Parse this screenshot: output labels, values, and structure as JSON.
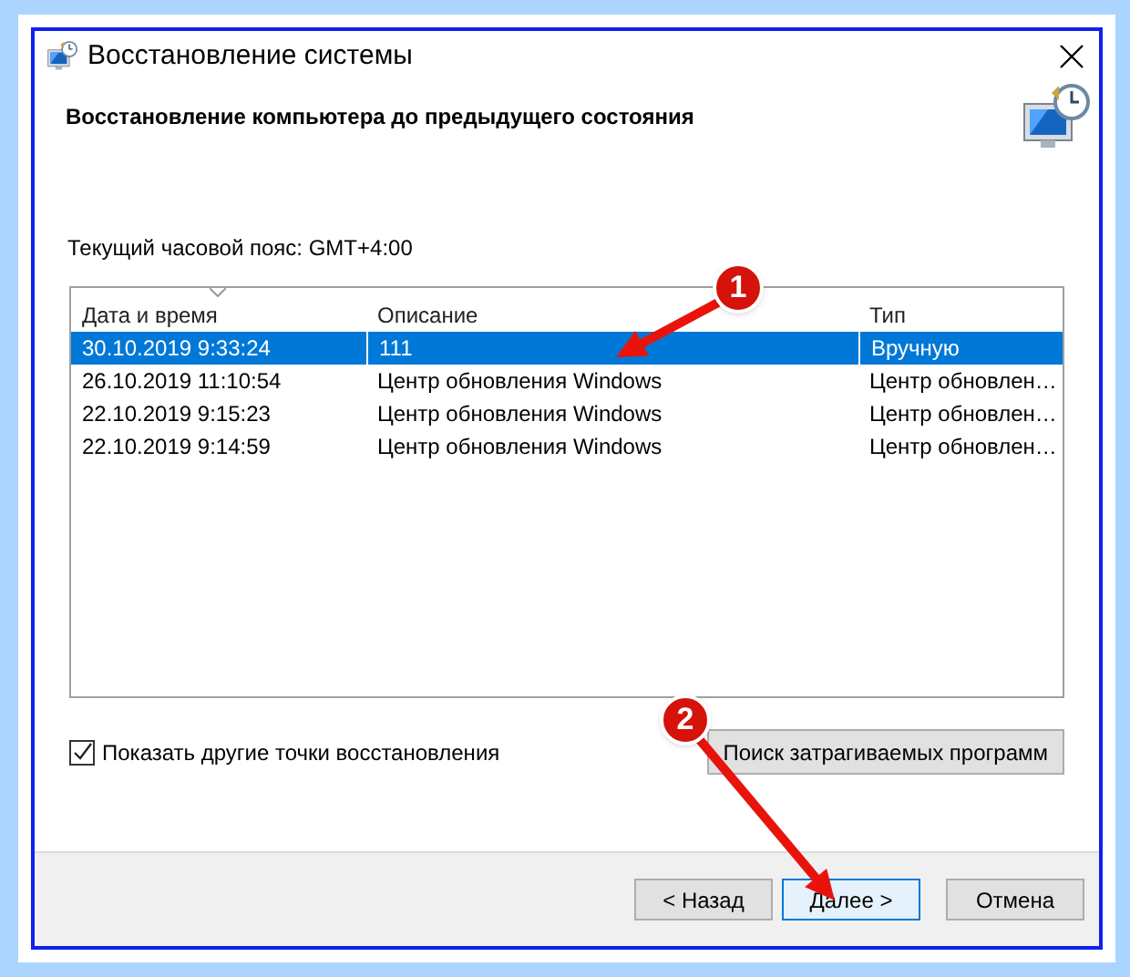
{
  "window": {
    "title": "Восстановление системы"
  },
  "heading": "Восстановление компьютера до предыдущего состояния",
  "timezone": "Текущий часовой пояс: GMT+4:00",
  "table": {
    "columns": [
      {
        "label": "Дата и время",
        "sorted": true
      },
      {
        "label": "Описание",
        "sorted": false
      },
      {
        "label": "Тип",
        "sorted": false
      }
    ],
    "rows": [
      {
        "cells": [
          "30.10.2019 9:33:24",
          "111",
          "Вручную"
        ],
        "selected": true
      },
      {
        "cells": [
          "26.10.2019 11:10:54",
          "Центр обновления Windows",
          "Центр обновлен…"
        ],
        "selected": false
      },
      {
        "cells": [
          "22.10.2019 9:15:23",
          "Центр обновления Windows",
          "Центр обновлен…"
        ],
        "selected": false
      },
      {
        "cells": [
          "22.10.2019 9:14:59",
          "Центр обновления Windows",
          "Центр обновлен…"
        ],
        "selected": false
      }
    ]
  },
  "show_more": {
    "label": "Показать другие точки восстановления",
    "checked": true
  },
  "scan_button": "Поиск затрагиваемых программ",
  "buttons": [
    {
      "label": "< Назад",
      "default": false
    },
    {
      "label": "Далее >",
      "default": true
    },
    {
      "label": "Отмена",
      "default": false
    }
  ],
  "annotations": [
    {
      "number": "1"
    },
    {
      "number": "2"
    }
  ]
}
